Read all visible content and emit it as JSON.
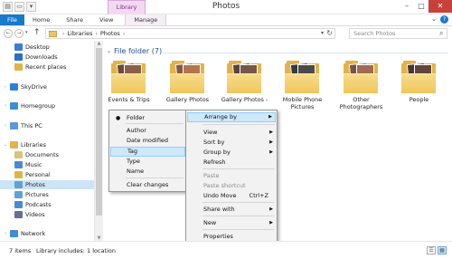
{
  "window": {
    "title": "Photos",
    "contextual_tab_group": "Library Tools",
    "minimize_glyph": "–",
    "maximize_glyph": "□",
    "close_glyph": "✕"
  },
  "quick_access": [
    {
      "name": "properties-icon",
      "glyph": "▤"
    },
    {
      "name": "new-folder-icon",
      "glyph": "▭"
    },
    {
      "name": "qat-dropdown-icon",
      "glyph": "▾"
    }
  ],
  "ribbon": {
    "tabs": [
      "File",
      "Home",
      "Share",
      "View",
      "Manage"
    ],
    "expand_glyph": "⌄",
    "help_glyph": "?"
  },
  "navigation": {
    "back_glyph": "←",
    "forward_glyph": "→",
    "recent_glyph": "▾",
    "up_glyph": "↑"
  },
  "address": {
    "breadcrumbs": [
      "Libraries",
      "Photos"
    ],
    "separator": "›",
    "dropdown_glyph": "▾",
    "refresh_glyph": "↻"
  },
  "search": {
    "placeholder": "Search Photos",
    "glyph": "⌕"
  },
  "nav_pane": {
    "items": [
      {
        "label": "Desktop",
        "indent": 1,
        "icon": "#3a7bd5"
      },
      {
        "label": "Downloads",
        "indent": 1,
        "icon": "#2b6fc9"
      },
      {
        "label": "Recent places",
        "indent": 1,
        "icon": "#e0b44a"
      },
      {
        "label": "SkyDrive",
        "indent": 0,
        "icon": "#2f7fd8",
        "chev": "›"
      },
      {
        "label": "Homegroup",
        "indent": 0,
        "icon": "#3f8fd4",
        "chev": "›"
      },
      {
        "label": "This PC",
        "indent": 0,
        "icon": "#5a9ad8",
        "chev": "›"
      },
      {
        "label": "Libraries",
        "indent": 0,
        "icon": "#e0b44a",
        "chev": "⌄"
      },
      {
        "label": "Documents",
        "indent": 1,
        "icon": "#d9c27a"
      },
      {
        "label": "Music",
        "indent": 1,
        "icon": "#4a8ad6"
      },
      {
        "label": "Personal",
        "indent": 1,
        "icon": "#e0b44a"
      },
      {
        "label": "Photos",
        "indent": 1,
        "icon": "#62a0d6",
        "selected": true
      },
      {
        "label": "Pictures",
        "indent": 1,
        "icon": "#62a0d6"
      },
      {
        "label": "Podcasts",
        "indent": 1,
        "icon": "#4a8ad6"
      },
      {
        "label": "Videos",
        "indent": 1,
        "icon": "#6b6b9a"
      },
      {
        "label": "Network",
        "indent": 0,
        "icon": "#3f8fd4",
        "chev": "›"
      }
    ],
    "scroll_up_glyph": "▲",
    "scroll_down_glyph": "▼"
  },
  "content": {
    "group_title": "File folder (7)",
    "group_chev": "⌄",
    "folders": [
      {
        "label": "Events & Trips",
        "photo": "#6b4a3a"
      },
      {
        "label": "Gallery Photos",
        "photo": "#8a5a3c"
      },
      {
        "label": "Gallery Photos -",
        "photo": "#5a4438"
      },
      {
        "label": "Mobile Phone Pictures",
        "photo": "#3a3a3a"
      },
      {
        "label": "Other Photographers",
        "photo": "#7a5240"
      },
      {
        "label": "People",
        "photo": "#4a3530"
      }
    ]
  },
  "arrange_submenu": {
    "items": [
      {
        "label": "Folder",
        "bullet": "●"
      },
      {
        "label": "Author"
      },
      {
        "label": "Date modified"
      },
      {
        "label": "Tag",
        "highlighted": true
      },
      {
        "label": "Type"
      },
      {
        "label": "Name"
      },
      {
        "label": "Clear changes"
      }
    ]
  },
  "context_menu": {
    "arrow_glyph": "▶",
    "items": [
      {
        "label": "Arrange by",
        "submenu": true,
        "highlighted": true
      },
      {
        "label": "View",
        "submenu": true
      },
      {
        "label": "Sort by",
        "submenu": true
      },
      {
        "label": "Group by",
        "submenu": true
      },
      {
        "label": "Refresh"
      },
      {
        "label": "Paste",
        "disabled": true
      },
      {
        "label": "Paste shortcut",
        "disabled": true
      },
      {
        "label": "Undo Move",
        "shortcut": "Ctrl+Z"
      },
      {
        "label": "Share with",
        "submenu": true
      },
      {
        "label": "New",
        "submenu": true
      },
      {
        "label": "Properties"
      }
    ]
  },
  "status": {
    "count": "7 items",
    "library": "Library includes: 1 location",
    "details_glyph": "☰",
    "icons_glyph": "▦"
  }
}
